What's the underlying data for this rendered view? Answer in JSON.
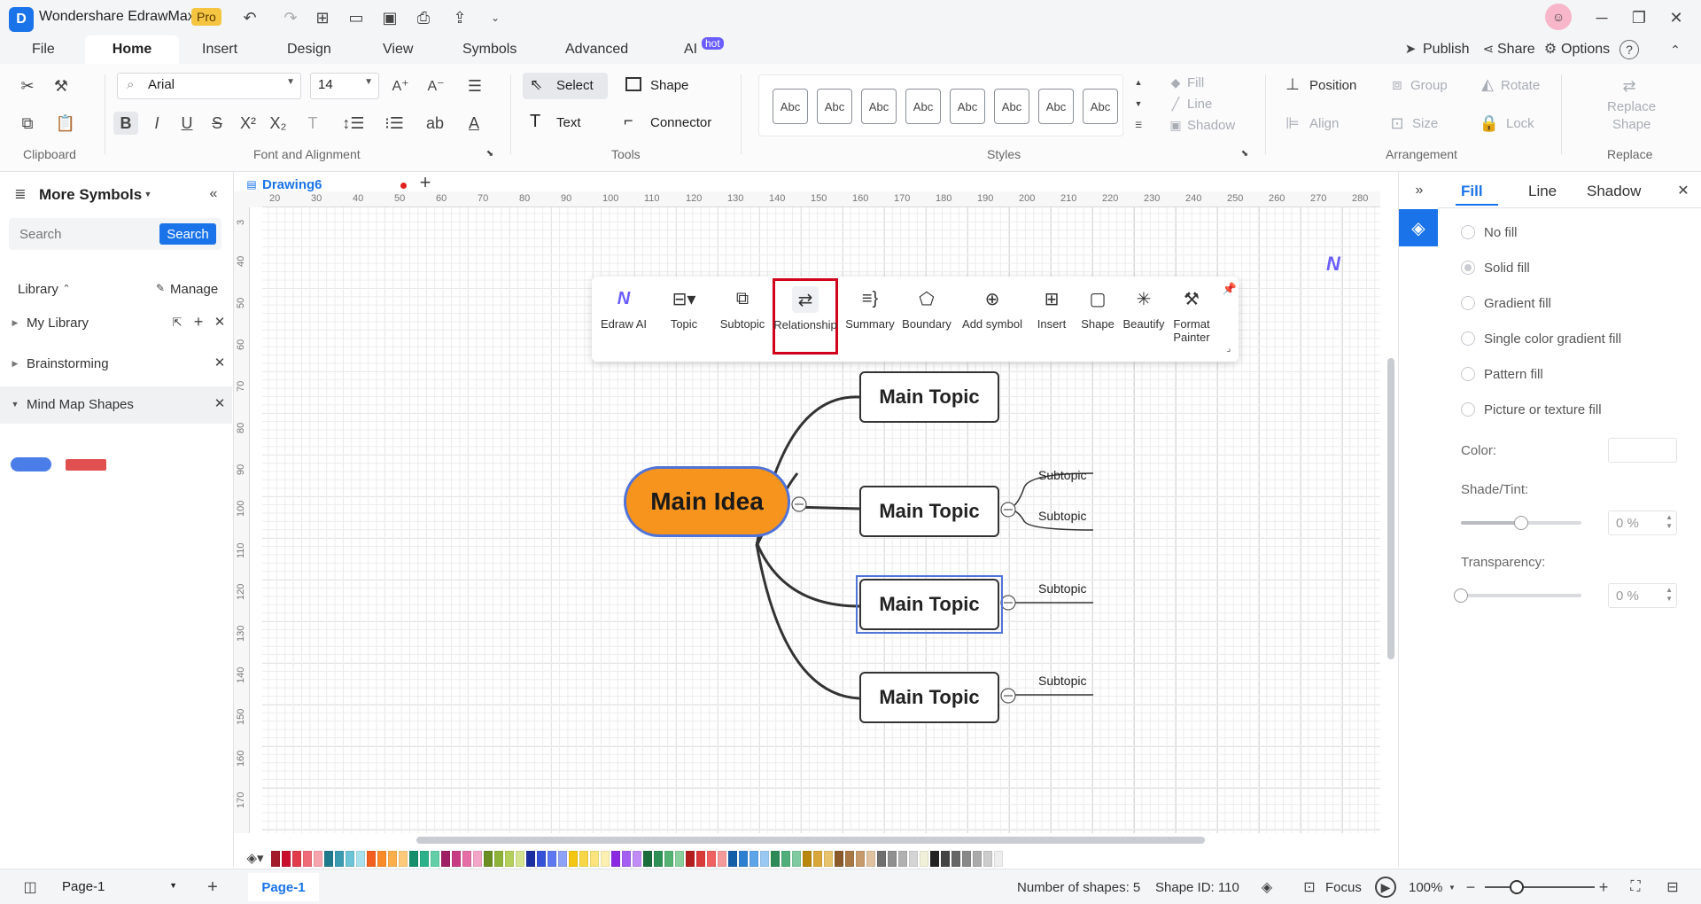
{
  "app": {
    "title": "Wondershare EdrawMax",
    "badge": "Pro",
    "hot_badge": "hot"
  },
  "menu": {
    "file": "File",
    "home": "Home",
    "insert": "Insert",
    "design": "Design",
    "view": "View",
    "symbols": "Symbols",
    "advanced": "Advanced",
    "ai": "AI"
  },
  "top_right": {
    "publish": "Publish",
    "share": "Share",
    "options": "Options"
  },
  "ribbon": {
    "font_name": "Arial",
    "font_size": "14",
    "select": "Select",
    "shape": "Shape",
    "text": "Text",
    "connector": "Connector",
    "style_abc": [
      "Abc",
      "Abc",
      "Abc",
      "Abc",
      "Abc",
      "Abc",
      "Abc",
      "Abc"
    ],
    "fill": "Fill",
    "line": "Line",
    "shadow": "Shadow",
    "position": "Position",
    "group": "Group",
    "rotate": "Rotate",
    "align": "Align",
    "size": "Size",
    "lock": "Lock",
    "replace_shape_1": "Replace",
    "replace_shape_2": "Shape",
    "groups": {
      "clipboard": "Clipboard",
      "font": "Font and Alignment",
      "tools": "Tools",
      "styles": "Styles",
      "arrangement": "Arrangement",
      "replace": "Replace"
    }
  },
  "left_panel": {
    "title": "More Symbols",
    "search_placeholder": "Search",
    "search_button": "Search",
    "library": "Library",
    "manage": "Manage",
    "items": [
      "My Library",
      "Brainstorming",
      "Mind Map Shapes"
    ]
  },
  "doc_tab": {
    "name": "Drawing6"
  },
  "ruler_h": [
    "20",
    "30",
    "40",
    "50",
    "60",
    "70",
    "80",
    "90",
    "100",
    "110",
    "120",
    "130",
    "140",
    "150",
    "160",
    "170",
    "180",
    "190",
    "200",
    "210",
    "220",
    "230",
    "240",
    "250",
    "260",
    "270",
    "280"
  ],
  "ruler_v": [
    "3",
    "40",
    "50",
    "60",
    "70",
    "80",
    "90",
    "100",
    "110",
    "120",
    "130",
    "140",
    "150",
    "160",
    "170"
  ],
  "floating_toolbar": {
    "items": [
      "Edraw AI",
      "Topic",
      "Subtopic",
      "Relationship",
      "Summary",
      "Boundary",
      "Add symbol",
      "Insert",
      "Shape",
      "Beautify",
      "Format"
    ],
    "format_line2": "Painter"
  },
  "mindmap": {
    "main_idea": "Main Idea",
    "topics": [
      "Main Topic",
      "Main Topic",
      "Main Topic",
      "Main Topic"
    ],
    "subtopics": [
      "Subtopic",
      "Subtopic",
      "Subtopic",
      "Subtopic"
    ]
  },
  "right_panel": {
    "tabs": [
      "Fill",
      "Line",
      "Shadow"
    ],
    "options": [
      "No fill",
      "Solid fill",
      "Gradient fill",
      "Single color gradient fill",
      "Pattern fill",
      "Picture or texture fill"
    ],
    "color_label": "Color:",
    "shade_label": "Shade/Tint:",
    "shade_value": "0 %",
    "transparency_label": "Transparency:",
    "transparency_value": "0 %",
    "shade_level": 0.5,
    "transparency_level": 0
  },
  "status": {
    "page_select": "Page-1",
    "page_tab": "Page-1",
    "shapes": "Number of shapes: 5",
    "shape_id": "Shape ID: 110",
    "focus": "Focus",
    "zoom": "100%"
  },
  "colors": {
    "accent": "#1a73e8",
    "main_idea": "#f7941d",
    "highlight": "#d0021b"
  }
}
